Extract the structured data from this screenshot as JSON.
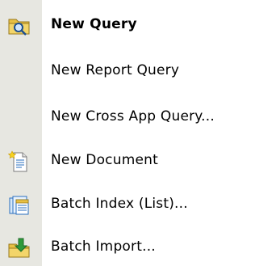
{
  "menu": {
    "items": [
      {
        "label": "New Query",
        "icon": "folder-search-icon",
        "bold": true
      },
      {
        "label": "New Report Query",
        "icon": "",
        "bold": false
      },
      {
        "label": "New Cross App Query...",
        "icon": "",
        "bold": false
      },
      {
        "label": "New Document",
        "icon": "new-document-icon",
        "bold": false
      },
      {
        "label": "Batch Index (List)...",
        "icon": "batch-index-icon",
        "bold": false
      },
      {
        "label": "Batch Import...",
        "icon": "batch-import-icon",
        "bold": false
      }
    ]
  },
  "colors": {
    "gutter": "#e7e7e1",
    "background": "#ffffff",
    "folder": "#e8c043",
    "accent_blue": "#2a6fbf",
    "accent_green": "#2e9a3a"
  }
}
